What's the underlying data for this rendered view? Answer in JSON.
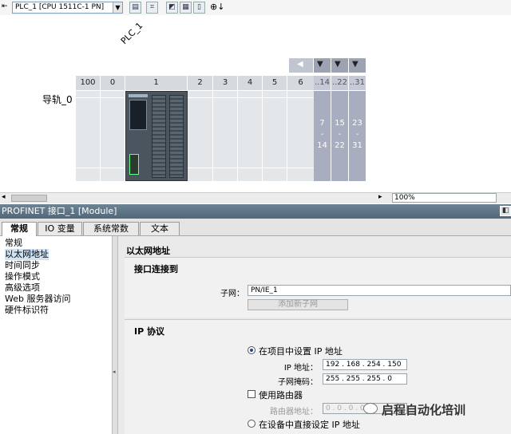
{
  "toolbar": {
    "device_select": "PLC_1 [CPU 1511C-1 PN]",
    "icons": [
      "device-table-icon",
      "network-view-icon",
      "split-view-icon",
      "grid-icon",
      "page-icon",
      "zoom-icon"
    ]
  },
  "canvas": {
    "plc_name": "PLC_1",
    "rail_label": "导轨_0",
    "slots": [
      "100",
      "0",
      "1",
      "2",
      "3",
      "4",
      "5",
      "6"
    ],
    "expansion_numbers": [
      "..14",
      "..22",
      "..31"
    ],
    "expansion_ranges": [
      {
        "top": "7",
        "mid": "-",
        "bot": "14"
      },
      {
        "top": "15",
        "mid": "-",
        "bot": "22"
      },
      {
        "top": "23",
        "mid": "-",
        "bot": "31"
      }
    ],
    "zoom": "100%"
  },
  "inspector": {
    "title": "PROFINET 接口_1 [Module]",
    "tabs": [
      "常规",
      "IO 变量",
      "系统常数",
      "文本"
    ],
    "nav": [
      "常规",
      "以太网地址",
      "时间同步",
      "操作模式",
      "高级选项",
      "Web 服务器访问",
      "硬件标识符"
    ],
    "selected_nav": 1,
    "section_title": "以太网地址",
    "interface_section": "接口连接到",
    "subnet_label": "子网：",
    "subnet_value": "PN/IE_1",
    "add_subnet_button": "添加新子网",
    "ip_section": "IP 协议",
    "radio_project": "在项目中设置 IP 地址",
    "ip_label": "IP 地址：",
    "ip_value": "192 . 168 . 254 . 150",
    "mask_label": "子网掩码：",
    "mask_value": "255 . 255 . 255 . 0",
    "use_router": "使用路由器",
    "router_label": "路由器地址：",
    "router_value": "0 . 0 . 0 . 0",
    "radio_device": "在设备中直接设定 IP 地址"
  },
  "watermark": "启程自动化培训"
}
